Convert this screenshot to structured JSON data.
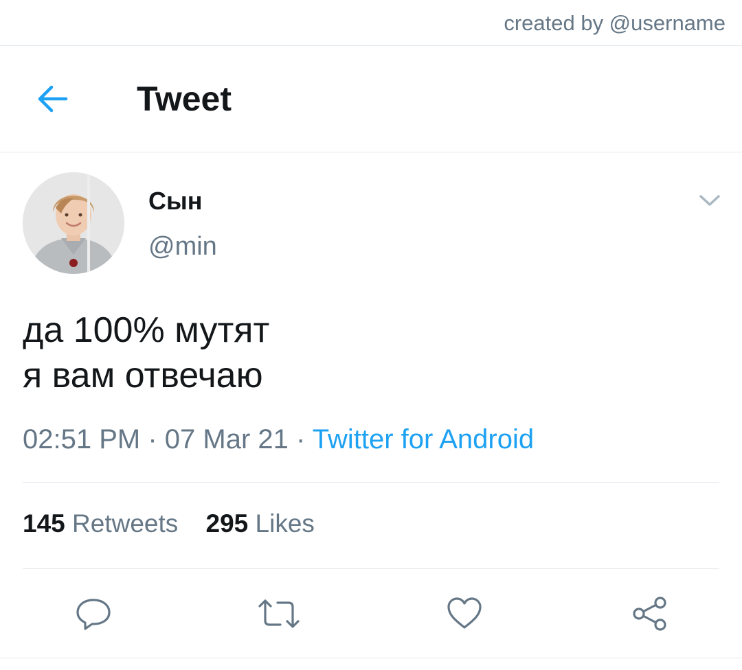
{
  "credit": "created by @username",
  "header": {
    "title": "Tweet",
    "back_icon": "arrow-left-icon"
  },
  "colors": {
    "accent": "#1da1f2",
    "text_primary": "#14171a",
    "text_secondary": "#657786",
    "divider": "#e1e8ed",
    "background": "#ffffff"
  },
  "tweet": {
    "author": {
      "display_name": "Сын",
      "handle": "@min"
    },
    "text_lines": [
      "да 100% мутят",
      "я вам отвечаю"
    ],
    "time": "02:51 PM",
    "date": "07 Mar 21",
    "separator": "·",
    "source": "Twitter for Android",
    "menu_icon": "chevron-down-icon"
  },
  "stats": {
    "retweets": {
      "count": "145",
      "label": "Retweets"
    },
    "likes": {
      "count": "295",
      "label": "Likes"
    }
  },
  "actions": [
    {
      "name": "reply",
      "icon": "reply-icon"
    },
    {
      "name": "retweet",
      "icon": "retweet-icon"
    },
    {
      "name": "like",
      "icon": "heart-icon"
    },
    {
      "name": "share",
      "icon": "share-icon"
    }
  ]
}
